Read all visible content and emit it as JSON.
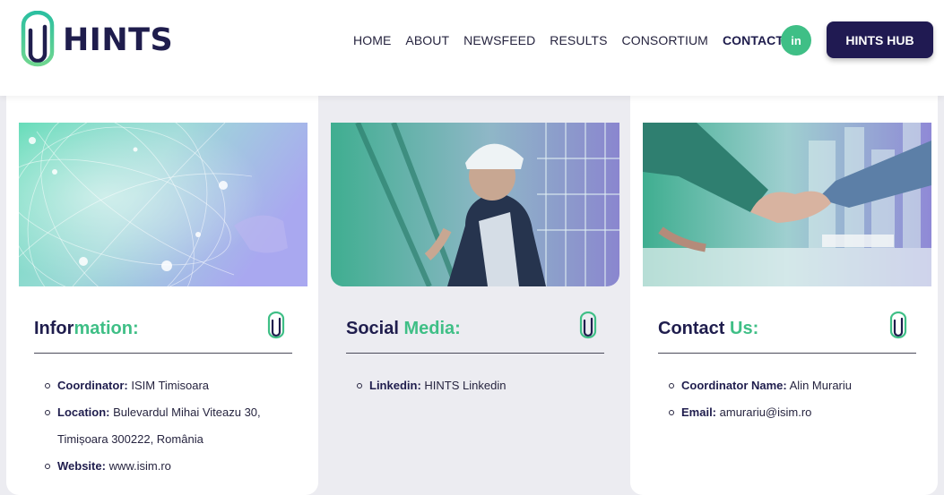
{
  "header": {
    "logo_text": "HINTS",
    "nav": [
      "HOME",
      "ABOUT",
      "NEWSFEED",
      "RESULTS",
      "CONSORTIUM",
      "CONTACT"
    ],
    "active_nav": "CONTACT",
    "linkedin_label": "in",
    "hub_button": "HINTS HUB"
  },
  "colors": {
    "brand_navy": "#1f1d4d",
    "accent_green": "#3fbf86",
    "hub_button_bg": "#201a52"
  },
  "cards": [
    {
      "title_main": "Infor",
      "title_accent": "mation:",
      "image": "network-globe-hand",
      "items": [
        {
          "label": "Coordinator:",
          "value": "ISIM Timisoara"
        },
        {
          "label": "Location:",
          "value": "Bulevardul Mihai Viteazu 30, Timișoara 300222, România"
        },
        {
          "label": "Website:",
          "value": "www.isim.ro"
        }
      ]
    },
    {
      "title_main": "Social ",
      "title_accent": "Media:",
      "image": "worker-in-hard-hat",
      "items": [
        {
          "label": "Linkedin:",
          "value": "HINTS Linkedin"
        }
      ]
    },
    {
      "title_main": "Contact ",
      "title_accent": "Us:",
      "image": "handshake",
      "items": [
        {
          "label": "Coordinator Name:",
          "value": "Alin Murariu"
        },
        {
          "label": "Email:",
          "value": "amurariu@isim.ro"
        }
      ]
    }
  ]
}
